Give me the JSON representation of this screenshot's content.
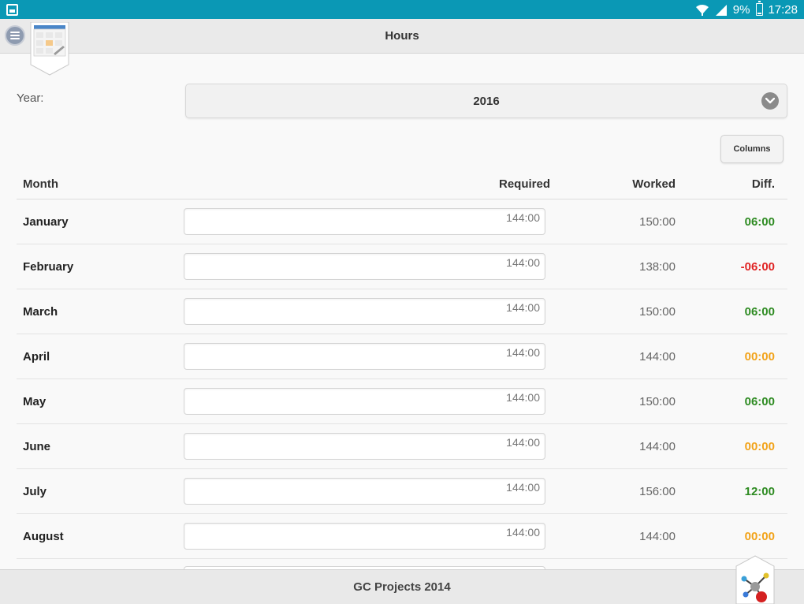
{
  "status_bar": {
    "battery": "9%",
    "time": "17:28"
  },
  "header": {
    "title": "Hours"
  },
  "year": {
    "label": "Year:",
    "value": "2016"
  },
  "columns_button": "Columns",
  "table": {
    "headers": {
      "month": "Month",
      "required": "Required",
      "worked": "Worked",
      "diff": "Diff."
    },
    "rows": [
      {
        "month": "January",
        "required": "144:00",
        "worked": "150:00",
        "diff": "06:00",
        "status": "positive"
      },
      {
        "month": "February",
        "required": "144:00",
        "worked": "138:00",
        "diff": "-06:00",
        "status": "negative"
      },
      {
        "month": "March",
        "required": "144:00",
        "worked": "150:00",
        "diff": "06:00",
        "status": "positive"
      },
      {
        "month": "April",
        "required": "144:00",
        "worked": "144:00",
        "diff": "00:00",
        "status": "zero"
      },
      {
        "month": "May",
        "required": "144:00",
        "worked": "150:00",
        "diff": "06:00",
        "status": "positive"
      },
      {
        "month": "June",
        "required": "144:00",
        "worked": "144:00",
        "diff": "00:00",
        "status": "zero"
      },
      {
        "month": "July",
        "required": "144:00",
        "worked": "156:00",
        "diff": "12:00",
        "status": "positive"
      },
      {
        "month": "August",
        "required": "144:00",
        "worked": "144:00",
        "diff": "00:00",
        "status": "zero"
      }
    ]
  },
  "colors": {
    "status_bar": "#0a98b5",
    "positive": "#2e8b22",
    "negative": "#e02424",
    "zero": "#f2a31a"
  },
  "footer": {
    "text": "GC Projects 2014"
  },
  "icons": {
    "menu": "hamburger-circle-icon",
    "calendar": "calendar-icon",
    "dropdown": "chevron-down-icon",
    "footer_logo": "molecule-icon"
  }
}
